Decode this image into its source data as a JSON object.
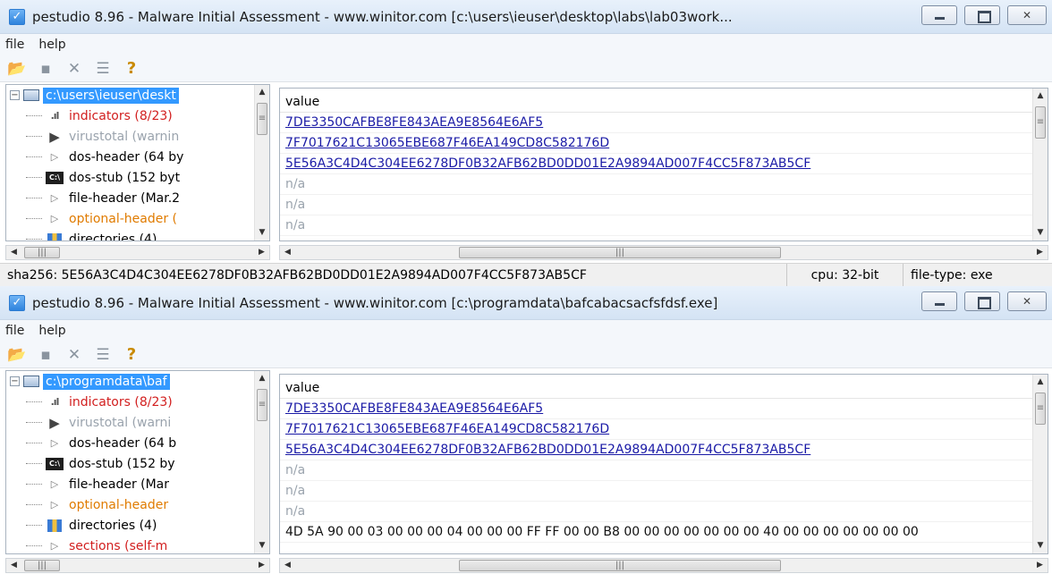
{
  "window1": {
    "title": "pestudio 8.96 - Malware Initial Assessment - www.winitor.com [c:\\users\\ieuser\\desktop\\labs\\lab03work...",
    "menu": [
      "file",
      "help"
    ],
    "tree": {
      "root": "c:\\users\\ieuser\\deskt",
      "items": [
        {
          "label": "indicators (8/23)",
          "icon": "bar-chart-icon"
        },
        {
          "label": "virustotal (warnin",
          "icon": "virustotal-icon"
        },
        {
          "label": "dos-header (64 by",
          "icon": "triangle-right-icon"
        },
        {
          "label": "dos-stub (152 byt",
          "icon": "command-prompt-icon"
        },
        {
          "label": "file-header (Mar.2",
          "icon": "triangle-right-icon"
        },
        {
          "label": "optional-header (",
          "icon": "triangle-right-icon"
        },
        {
          "label": "directories (4)",
          "icon": "grid-icon"
        }
      ]
    },
    "value_header": "value",
    "values": [
      {
        "text": "7DE3350CAFBE8FE843AEA9E8564E6AF5",
        "kind": "link"
      },
      {
        "text": "7F7017621C13065EBE687F46EA149CD8C582176D",
        "kind": "link"
      },
      {
        "text": "5E56A3C4D4C304EE6278DF0B32AFB62BD0DD01E2A9894AD007F4CC5F873AB5CF",
        "kind": "link"
      },
      {
        "text": "n/a",
        "kind": "na"
      },
      {
        "text": "n/a",
        "kind": "na"
      },
      {
        "text": "n/a",
        "kind": "na"
      }
    ],
    "status": {
      "sha256": "sha256: 5E56A3C4D4C304EE6278DF0B32AFB62BD0DD01E2A9894AD007F4CC5F873AB5CF",
      "cpu": "cpu: 32-bit",
      "file_type": "file-type: exe"
    }
  },
  "window2": {
    "title": "pestudio 8.96 - Malware Initial Assessment - www.winitor.com [c:\\programdata\\bafcabacsacfsfdsf.exe]",
    "menu": [
      "file",
      "help"
    ],
    "tree": {
      "root": "c:\\programdata\\baf",
      "items": [
        {
          "label": "indicators (8/23)",
          "icon": "bar-chart-icon"
        },
        {
          "label": "virustotal (warni",
          "icon": "virustotal-icon"
        },
        {
          "label": "dos-header (64 b",
          "icon": "triangle-right-icon"
        },
        {
          "label": "dos-stub (152 by",
          "icon": "command-prompt-icon"
        },
        {
          "label": "file-header (Mar",
          "icon": "triangle-right-icon"
        },
        {
          "label": "optional-header",
          "icon": "triangle-right-icon"
        },
        {
          "label": "directories (4)",
          "icon": "grid-icon"
        },
        {
          "label": "sections (self-m",
          "icon": "triangle-right-icon"
        }
      ]
    },
    "value_header": "value",
    "values": [
      {
        "text": "7DE3350CAFBE8FE843AEA9E8564E6AF5",
        "kind": "link"
      },
      {
        "text": "7F7017621C13065EBE687F46EA149CD8C582176D",
        "kind": "link"
      },
      {
        "text": "5E56A3C4D4C304EE6278DF0B32AFB62BD0DD01E2A9894AD007F4CC5F873AB5CF",
        "kind": "link"
      },
      {
        "text": "n/a",
        "kind": "na"
      },
      {
        "text": "n/a",
        "kind": "na"
      },
      {
        "text": "n/a",
        "kind": "na"
      },
      {
        "text": "4D 5A 90 00 03 00 00 00 04 00 00 00 FF FF 00 00 B8 00 00 00 00 00 00 00 40 00 00 00 00 00 00 00",
        "kind": "hex"
      }
    ]
  },
  "colors": {
    "selection": "#3399ff",
    "link": "#1a1aa6",
    "indicator_red": "#d21f1f",
    "orange": "#e07b00",
    "muted": "#9aa3ad"
  }
}
